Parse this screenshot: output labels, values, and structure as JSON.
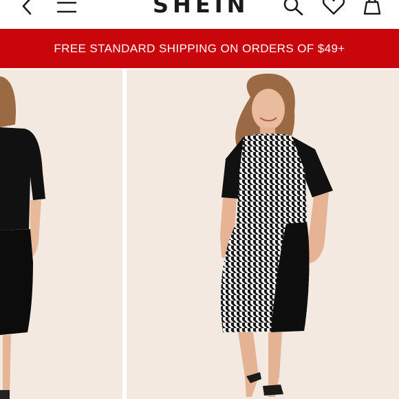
{
  "header": {
    "brand": "SHEIN",
    "icons": [
      "back-arrow-icon",
      "menu-icon",
      "search-icon",
      "heart-icon",
      "shopping-bag-icon"
    ]
  },
  "banner": {
    "text": "FREE STANDARD SHIPPING ON ORDERS OF $49+"
  },
  "colors": {
    "banner_red": "#c8060c",
    "photo_background": "#f4e9e0",
    "text_dark": "#1a1a1a"
  }
}
